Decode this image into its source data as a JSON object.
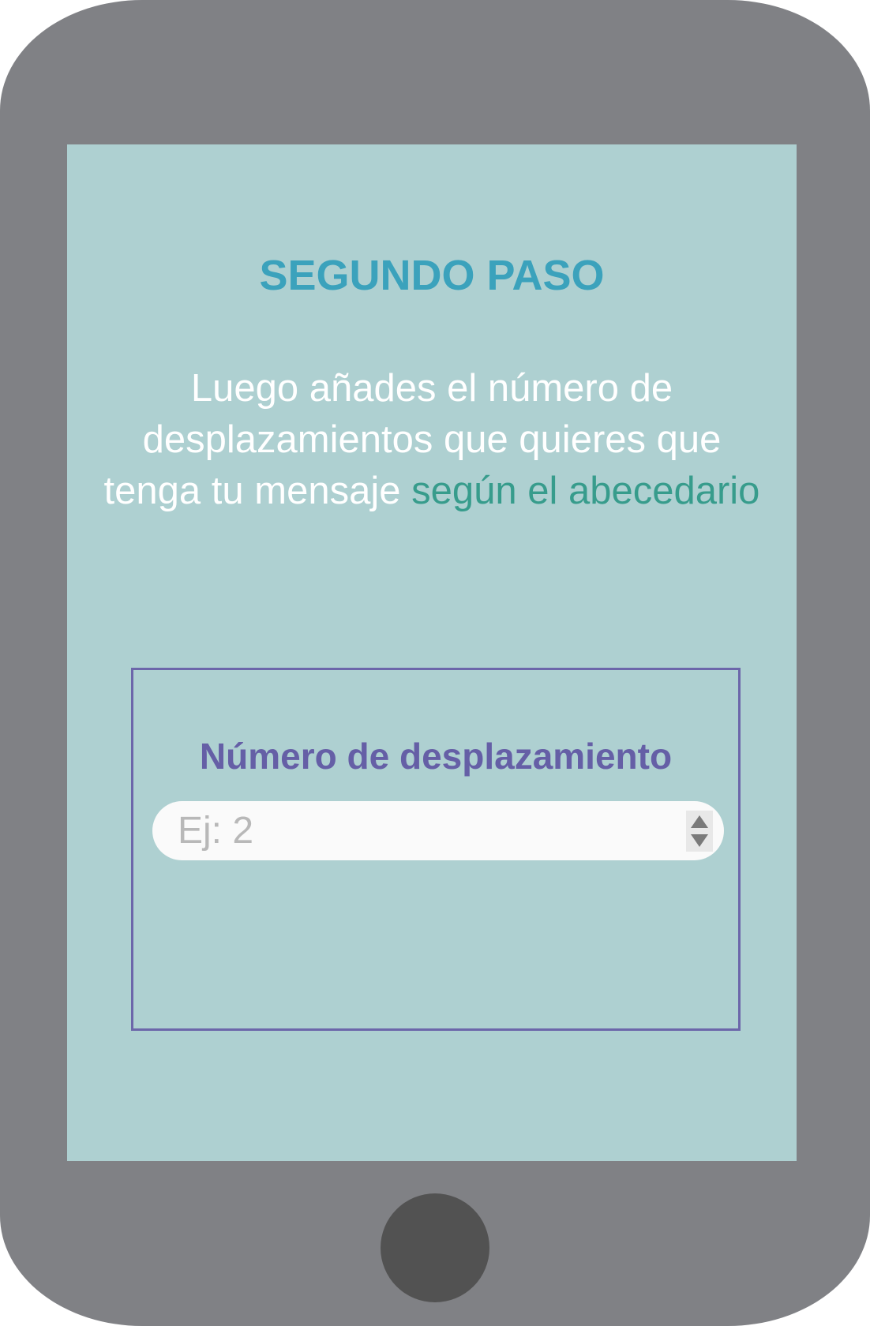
{
  "screen": {
    "title": "SEGUNDO PASO",
    "description": {
      "text": "Luego añades el número de desplazamientos que quieres que tenga tu mensaje ",
      "highlight": "según el abecedario"
    }
  },
  "form": {
    "label": "Número de desplazamiento",
    "input": {
      "value": "",
      "placeholder": "Ej: 2"
    },
    "stepper": {
      "up_icon": "triangle-up",
      "down_icon": "triangle-down"
    }
  },
  "colors": {
    "device": "#808185",
    "screen": "#aed0d1",
    "title": "#3ba2bc",
    "highlight": "#379c8c",
    "accent": "#655fa6",
    "home_button": "#525252"
  }
}
